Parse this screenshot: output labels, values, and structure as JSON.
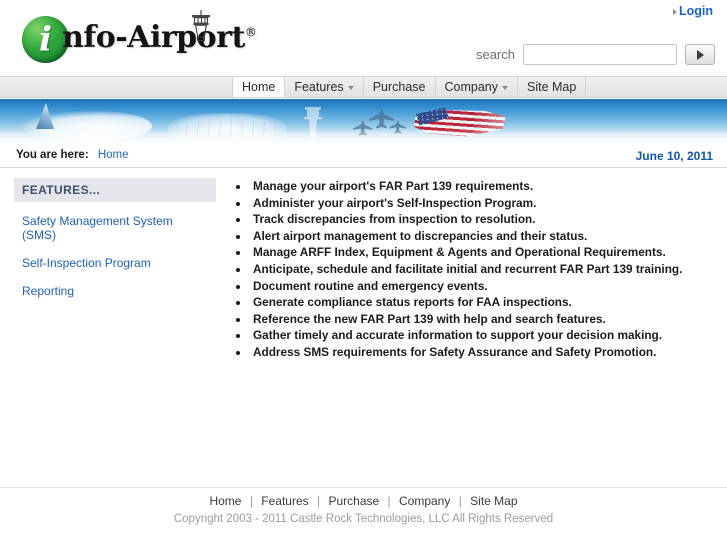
{
  "brand": {
    "logo_initial": "i",
    "logo_text": "nfo-Airport",
    "logo_registered": "®",
    "tower_icon": "control-tower-icon"
  },
  "header": {
    "login_label": "Login",
    "search_label": "search",
    "search_value": "",
    "search_placeholder": "",
    "search_button_icon": "go-arrow-icon"
  },
  "nav": {
    "items": [
      {
        "label": "Home",
        "active": true,
        "has_dropdown": false
      },
      {
        "label": "Features",
        "active": false,
        "has_dropdown": true
      },
      {
        "label": "Purchase",
        "active": false,
        "has_dropdown": false
      },
      {
        "label": "Company",
        "active": false,
        "has_dropdown": true
      },
      {
        "label": "Site Map",
        "active": false,
        "has_dropdown": false
      }
    ]
  },
  "banner": {
    "images": [
      "jumbo-jet",
      "aircraft-hangar",
      "control-tower",
      "fighter-jets",
      "american-flag"
    ],
    "gradient_top": "#1b73b8",
    "gradient_bottom": "#f4fafd"
  },
  "breadcrumb": {
    "prefix": "You are here:",
    "current": "Home",
    "date": "June 10, 2011"
  },
  "sidebar": {
    "heading": "FEATURES...",
    "items": [
      {
        "label": "Safety Management System (SMS)"
      },
      {
        "label": "Self-Inspection Program"
      },
      {
        "label": "Reporting"
      }
    ]
  },
  "main": {
    "bullets": [
      "Manage your airport's FAR Part 139 requirements.",
      "Administer your airport's Self-Inspection Program.",
      "Track discrepancies from inspection to resolution.",
      "Alert airport management to discrepancies and their status.",
      "Manage ARFF Index, Equipment & Agents and Operational Requirements.",
      "Anticipate, schedule and facilitate initial and recurrent FAR Part 139 training.",
      "Document routine and emergency events.",
      "Generate compliance status reports for FAA inspections.",
      "Reference the new FAR Part 139 with help and search features.",
      "Gather timely and accurate information to support your decision making.",
      "Address SMS requirements for Safety Assurance and Safety Promotion."
    ]
  },
  "footer": {
    "links": [
      "Home",
      "Features",
      "Purchase",
      "Company",
      "Site Map"
    ],
    "separator": "|",
    "copyright": "Copyright 2003 - 2011 Castle Rock Technologies, LLC All Rights Reserved"
  },
  "colors": {
    "link_blue": "#1e5fb4",
    "login_blue": "#1566c8",
    "date_blue": "#1257ae",
    "logo_green": "#32a83f",
    "sidebar_head_bg": "#e4e6ec"
  }
}
